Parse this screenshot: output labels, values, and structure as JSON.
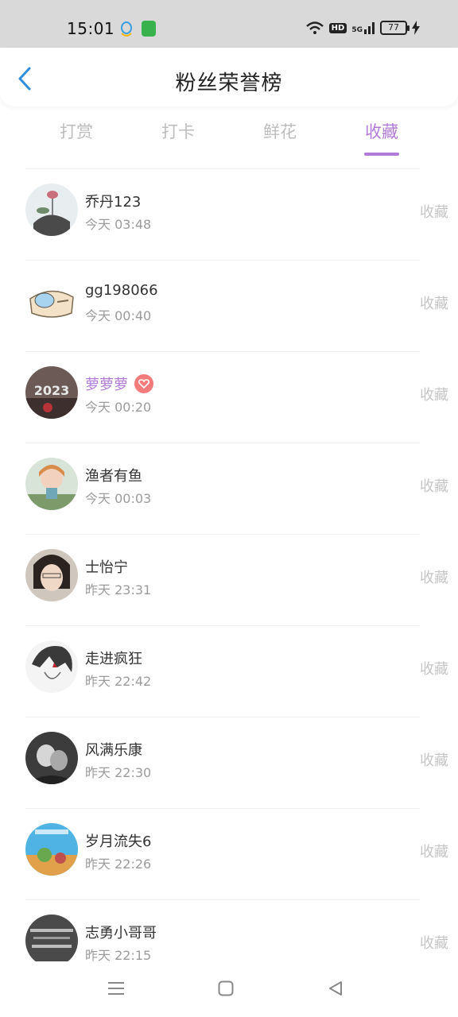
{
  "status": {
    "time": "15:01",
    "hd": "HD",
    "network": "5G",
    "battery": "77"
  },
  "header": {
    "title": "粉丝荣誉榜"
  },
  "tabs": [
    {
      "label": "打赏",
      "active": false
    },
    {
      "label": "打卡",
      "active": false
    },
    {
      "label": "鲜花",
      "active": false
    },
    {
      "label": "收藏",
      "active": true
    }
  ],
  "colors": {
    "accent": "#b07cd8",
    "back": "#2f8fdd",
    "muted": "#bdbdbd"
  },
  "fans": [
    {
      "name": "乔丹123",
      "time": "今天 03:48",
      "action": "收藏",
      "vip": false,
      "avatar": "lotus-painting"
    },
    {
      "name": "gg198066",
      "time": "今天 00:40",
      "action": "收藏",
      "vip": false,
      "avatar": "cartoon-cake"
    },
    {
      "name": "萝萝萝",
      "time": "今天 00:20",
      "action": "收藏",
      "vip": true,
      "avatar": "year-2023-balloons"
    },
    {
      "name": "渔者有鱼",
      "time": "今天 00:03",
      "action": "收藏",
      "vip": false,
      "avatar": "doll"
    },
    {
      "name": "士怡宁",
      "time": "昨天 23:31",
      "action": "收藏",
      "vip": false,
      "avatar": "girl-photo"
    },
    {
      "name": "走进疯狂",
      "time": "昨天 22:42",
      "action": "收藏",
      "vip": false,
      "avatar": "anime-sketch"
    },
    {
      "name": "风满乐康",
      "time": "昨天 22:30",
      "action": "收藏",
      "vip": false,
      "avatar": "couple-bw"
    },
    {
      "name": "岁月流失6",
      "time": "昨天 22:26",
      "action": "收藏",
      "vip": false,
      "avatar": "cartoon-landscape"
    },
    {
      "name": "志勇小哥哥",
      "time": "昨天 22:15",
      "action": "收藏",
      "vip": false,
      "avatar": "text-image"
    }
  ]
}
